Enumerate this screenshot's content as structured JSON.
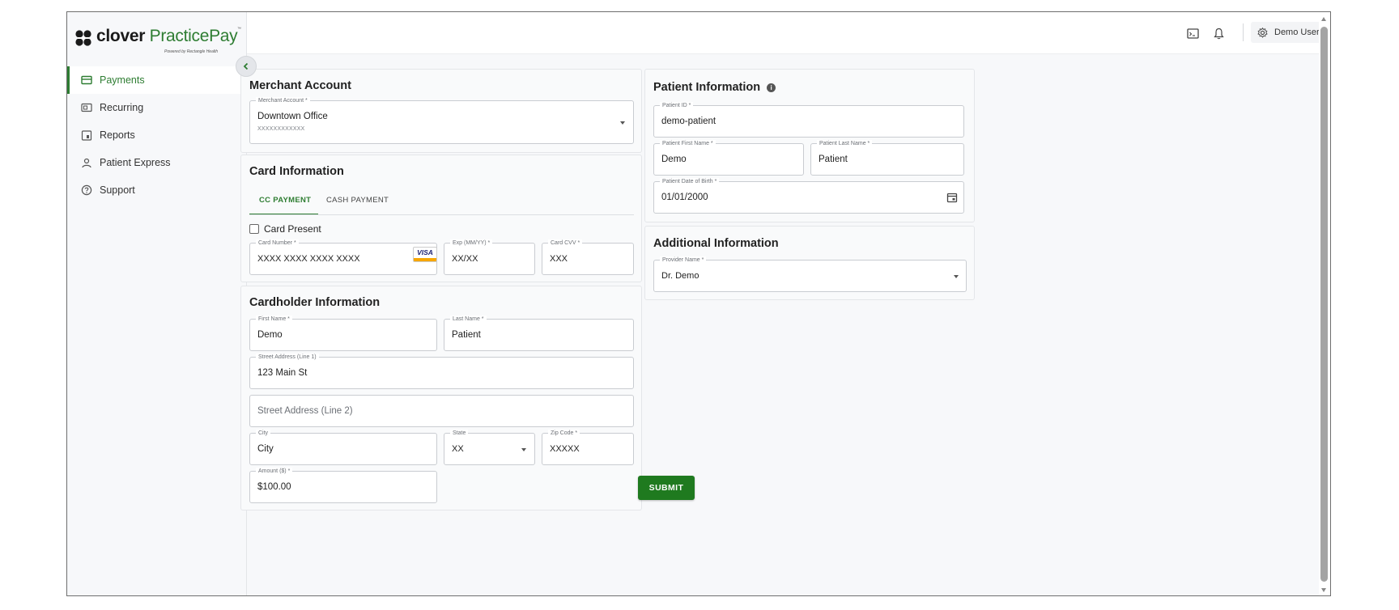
{
  "brand": {
    "name_part1": "clover",
    "name_part2": "PracticePay",
    "trademark": "™",
    "tagline": "Powered by Rectangle Health",
    "accent_color": "#2e7d32"
  },
  "sidebar": {
    "items": [
      {
        "label": "Payments",
        "icon": "card-icon",
        "active": true
      },
      {
        "label": "Recurring",
        "icon": "recurring-icon",
        "active": false
      },
      {
        "label": "Reports",
        "icon": "reports-icon",
        "active": false
      },
      {
        "label": "Patient Express",
        "icon": "person-icon",
        "active": false
      },
      {
        "label": "Support",
        "icon": "help-icon",
        "active": false
      }
    ]
  },
  "header": {
    "user_name": "Demo User",
    "icons": [
      "terminal-icon",
      "bell-icon",
      "gear-icon"
    ]
  },
  "merchant": {
    "title": "Merchant Account",
    "account_label": "Merchant Account *",
    "account_value": "Downtown Office",
    "account_sub": "XXXXXXXXXXXX"
  },
  "card_info": {
    "title": "Card Information",
    "tabs": [
      {
        "label": "CC PAYMENT",
        "active": true
      },
      {
        "label": "CASH PAYMENT",
        "active": false
      }
    ],
    "card_present_label": "Card Present",
    "card_present_checked": false,
    "card_number_label": "Card Number *",
    "card_number_value": "XXXX XXXX XXXX XXXX",
    "card_brand": "VISA",
    "exp_label": "Exp (MM/YY) *",
    "exp_value": "XX/XX",
    "cvv_label": "Card CVV *",
    "cvv_value": "XXX"
  },
  "cardholder": {
    "title": "Cardholder Information",
    "first_name_label": "First Name *",
    "first_name_value": "Demo",
    "last_name_label": "Last Name *",
    "last_name_value": "Patient",
    "street1_label": "Street Address (Line 1)",
    "street1_value": "123 Main St",
    "street2_placeholder": "Street Address (Line 2)",
    "city_label": "City",
    "city_value": "City",
    "state_label": "State",
    "state_value": "XX",
    "zip_label": "Zip Code *",
    "zip_value": "XXXXX",
    "amount_label": "Amount ($) *",
    "amount_value": "$100.00",
    "submit_label": "SUBMIT"
  },
  "patient": {
    "title": "Patient Information",
    "patient_id_label": "Patient ID *",
    "patient_id_value": "demo-patient",
    "first_name_label": "Patient First Name *",
    "first_name_value": "Demo",
    "last_name_label": "Patient Last Name *",
    "last_name_value": "Patient",
    "dob_label": "Patient Date of Birth *",
    "dob_value": "01/01/2000"
  },
  "additional": {
    "title": "Additional Information",
    "provider_label": "Provider Name *",
    "provider_value": "Dr. Demo"
  }
}
